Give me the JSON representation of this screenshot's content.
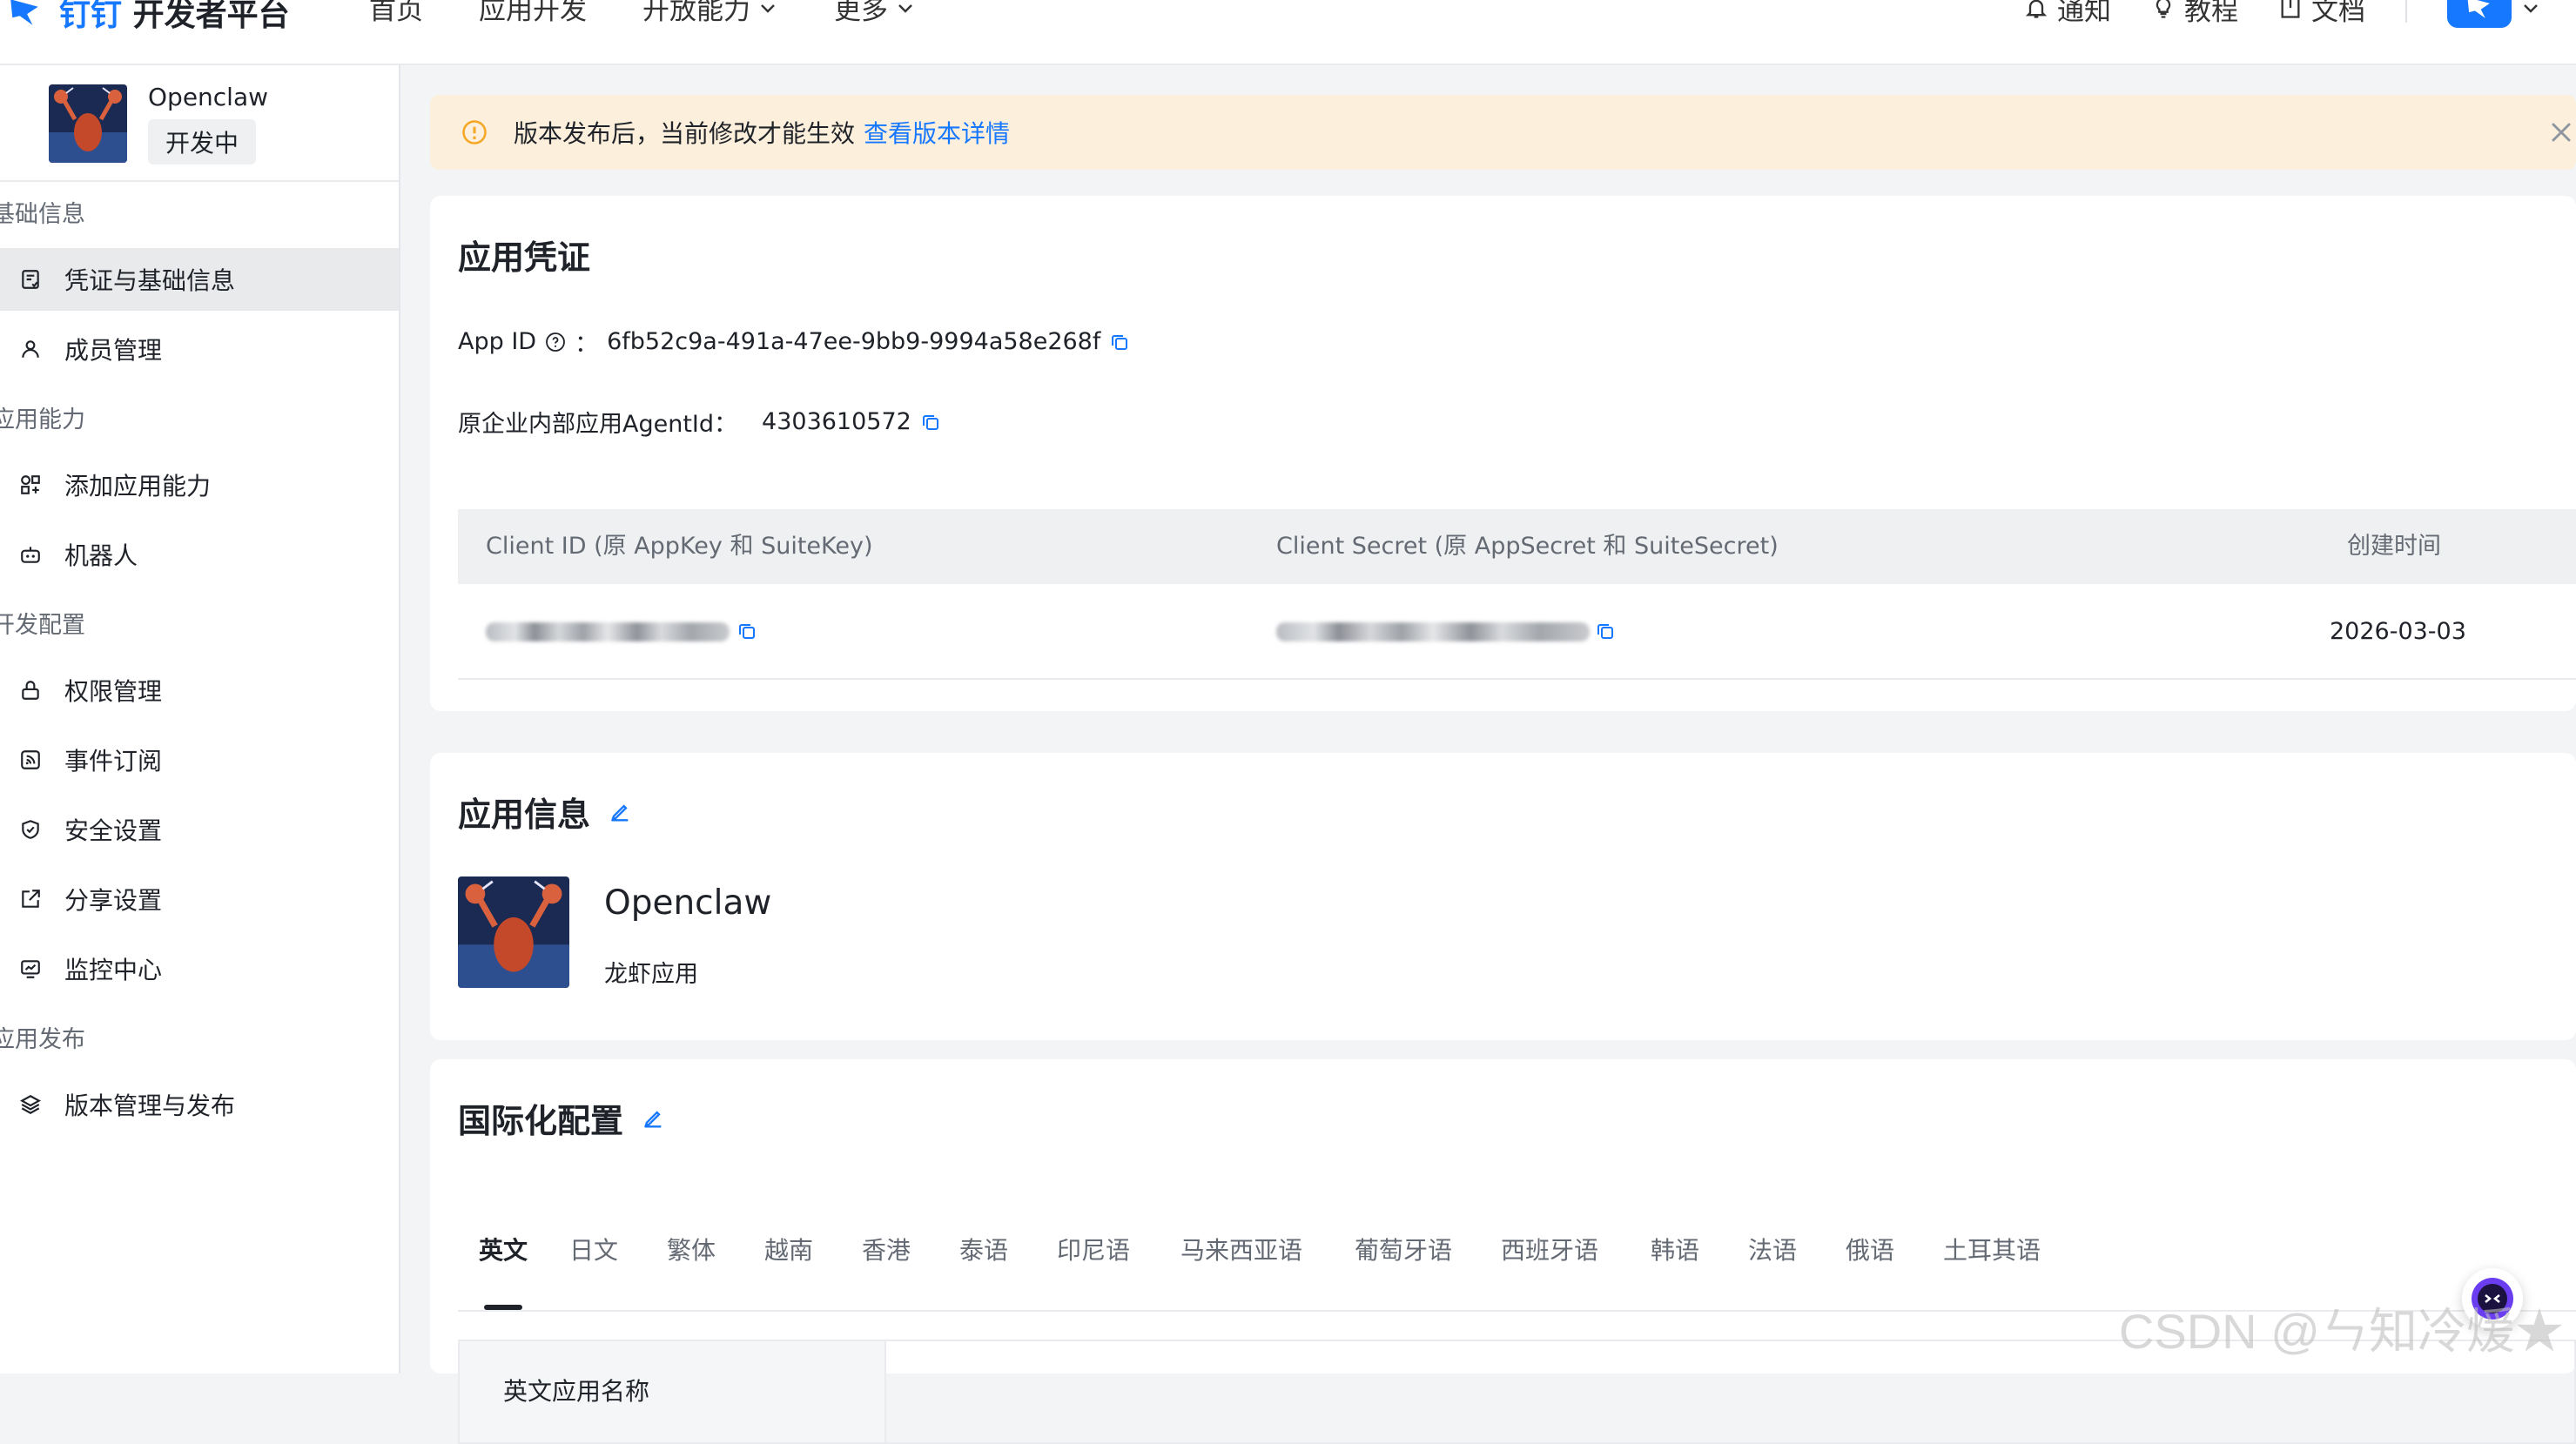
{
  "topbar": {
    "brand_left": "钉钉",
    "brand_right": "开发者平台",
    "nav": [
      {
        "label": "首页",
        "has_dropdown": false
      },
      {
        "label": "应用开发",
        "has_dropdown": false
      },
      {
        "label": "开放能力",
        "has_dropdown": true
      },
      {
        "label": "更多",
        "has_dropdown": true
      }
    ],
    "right": {
      "notify": "通知",
      "tutorial": "教程",
      "docs": "文档"
    }
  },
  "sidebar": {
    "app_name": "Openclaw",
    "app_status": "开发中",
    "groups": [
      {
        "title": "基础信息",
        "items": [
          {
            "label": "凭证与基础信息",
            "icon": "credential-icon",
            "active": true
          },
          {
            "label": "成员管理",
            "icon": "user-icon",
            "active": false
          }
        ]
      },
      {
        "title": "应用能力",
        "items": [
          {
            "label": "添加应用能力",
            "icon": "apps-icon",
            "active": false
          },
          {
            "label": "机器人",
            "icon": "robot-icon",
            "active": false
          }
        ]
      },
      {
        "title": "开发配置",
        "items": [
          {
            "label": "权限管理",
            "icon": "lock-icon",
            "active": false
          },
          {
            "label": "事件订阅",
            "icon": "rss-icon",
            "active": false
          },
          {
            "label": "安全设置",
            "icon": "shield-icon",
            "active": false
          },
          {
            "label": "分享设置",
            "icon": "share-icon",
            "active": false
          },
          {
            "label": "监控中心",
            "icon": "monitor-icon",
            "active": false
          }
        ]
      },
      {
        "title": "应用发布",
        "items": [
          {
            "label": "版本管理与发布",
            "icon": "layers-icon",
            "active": false
          }
        ]
      }
    ]
  },
  "notice": {
    "text": "版本发布后，当前修改才能生效",
    "link": "查看版本详情"
  },
  "credentials": {
    "title": "应用凭证",
    "app_id_label": "App ID",
    "app_id_sep": "：",
    "app_id_value": "6fb52c9a-491a-47ee-9bb9-9994a58e268f",
    "agent_label": "原企业内部应用AgentId：",
    "agent_value": "4303610572",
    "table_headers": {
      "client_id": "Client ID (原 AppKey 和 SuiteKey)",
      "client_secret": "Client Secret (原 AppSecret 和 SuiteSecret)",
      "created": "创建时间"
    },
    "row_created": "2026-03-03"
  },
  "app_info": {
    "title": "应用信息",
    "name": "Openclaw",
    "description": "龙虾应用"
  },
  "i18n": {
    "title": "国际化配置",
    "tabs": [
      "英文",
      "日文",
      "繁体",
      "越南",
      "香港",
      "泰语",
      "印尼语",
      "马来西亚语",
      "葡萄牙语",
      "西班牙语",
      "韩语",
      "法语",
      "俄语",
      "土耳其语"
    ],
    "active_tab": "英文",
    "field_label": "英文应用名称"
  },
  "watermark": "CSDN @ㄣ知冷煖★",
  "colors": {
    "accent": "#1677ff",
    "notice_bg": "#fcefdc",
    "notice_icon": "#f5a623"
  }
}
